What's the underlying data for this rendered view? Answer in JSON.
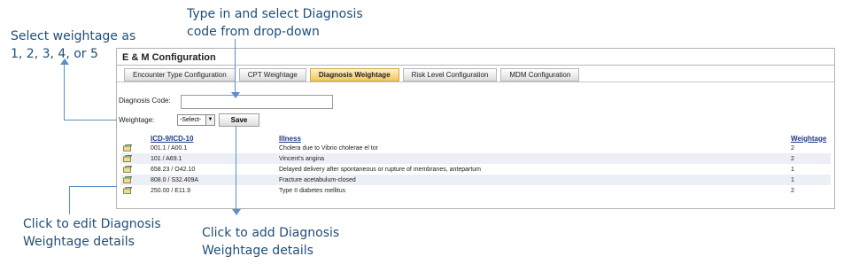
{
  "callouts": {
    "weightage_line1": "Select weightage  as",
    "weightage_line2": "1, 2, 3, 4, or 5",
    "diagnosis_line1": "Type in and select Diagnosis",
    "diagnosis_line2": "code from drop-down",
    "edit_line1": "Click to edit Diagnosis",
    "edit_line2": "Weightage details",
    "add_line1": "Click to add Diagnosis",
    "add_line2": "Weightage details"
  },
  "panel": {
    "title": "E & M Configuration",
    "tabs": [
      {
        "label": "Encounter Type Configuration",
        "active": false
      },
      {
        "label": "CPT Weightage",
        "active": false
      },
      {
        "label": "Diagnosis Weightage",
        "active": true
      },
      {
        "label": "Risk Level Configuration",
        "active": false
      },
      {
        "label": "MDM Configuration",
        "active": false
      }
    ]
  },
  "form": {
    "diagnosis_label": "Diagnosis Code:",
    "diagnosis_value": "",
    "weightage_label": "Weightage:",
    "weightage_selected": "-Select-",
    "save_label": "Save"
  },
  "table": {
    "headers": [
      "ICD-9/ICD-10",
      "Illness",
      "Weightage"
    ],
    "rows": [
      {
        "code": "001.1 / A00.1",
        "illness": "Cholera due to Vibrio cholerae el tor",
        "weightage": "2"
      },
      {
        "code": "101 / A69.1",
        "illness": "Vincent's angina",
        "weightage": "2"
      },
      {
        "code": "658.23 / O42.10",
        "illness": "Delayed delivery after spontaneous or rupture of membranes, antepartum",
        "weightage": "1"
      },
      {
        "code": "808.0 / S32.409A",
        "illness": "Fracture acetabulum-closed",
        "weightage": "1"
      },
      {
        "code": "250.00 / E11.9",
        "illness": "Type II diabetes mellitus",
        "weightage": "2"
      }
    ]
  },
  "colors": {
    "accent": "#1f4e79",
    "active_tab": "#f2c75c",
    "arrow": "#5b8fc9"
  }
}
